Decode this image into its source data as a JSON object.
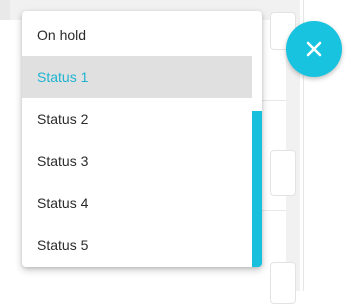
{
  "menu": {
    "items": [
      {
        "label": "On hold"
      },
      {
        "label": "Status 1"
      },
      {
        "label": "Status 2"
      },
      {
        "label": "Status 3"
      },
      {
        "label": "Status 4"
      },
      {
        "label": "Status 5"
      }
    ],
    "selected_label": "Status 1"
  },
  "fab": {
    "icon": "close-icon"
  },
  "colors": {
    "accent": "#19c0dd",
    "selected_text": "#1fb3d1",
    "selected_bg": "#e0e0e0"
  }
}
